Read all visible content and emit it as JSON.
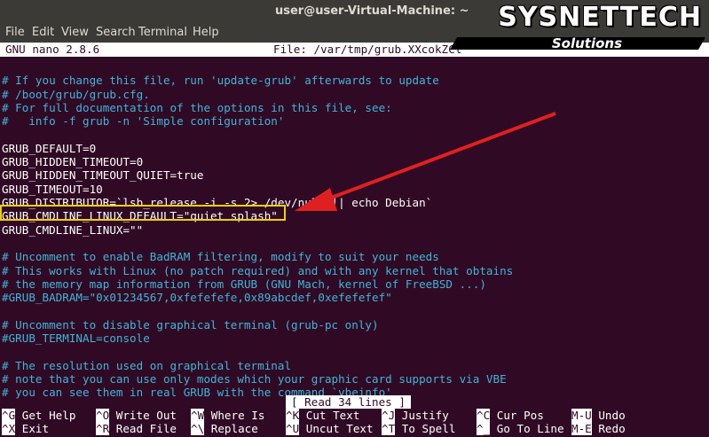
{
  "window": {
    "title": "user@user-Virtual-Machine: ~"
  },
  "menu": {
    "items": [
      "File",
      "Edit",
      "View",
      "Search",
      "Terminal",
      "Help"
    ]
  },
  "nano": {
    "version": "GNU nano 2.8.6",
    "file": "File: /var/tmp/grub.XXcokZCl",
    "lines": [
      {
        "text": "",
        "type": "plain"
      },
      {
        "text": "# If you change this file, run 'update-grub' afterwards to update",
        "type": "comment"
      },
      {
        "text": "# /boot/grub/grub.cfg.",
        "type": "comment"
      },
      {
        "text": "# For full documentation of the options in this file, see:",
        "type": "comment"
      },
      {
        "text": "#   info -f grub -n 'Simple configuration'",
        "type": "comment"
      },
      {
        "text": "",
        "type": "plain"
      },
      {
        "text": "GRUB_DEFAULT=0",
        "type": "plain"
      },
      {
        "text": "GRUB_HIDDEN_TIMEOUT=0",
        "type": "plain"
      },
      {
        "text": "GRUB_HIDDEN_TIMEOUT_QUIET=true",
        "type": "plain"
      },
      {
        "text": "GRUB_TIMEOUT=10",
        "type": "plain"
      },
      {
        "text": "GRUB_DISTRIBUTOR=`lsb_release -i -s 2> /dev/null || echo Debian`",
        "type": "plain"
      },
      {
        "text": "GRUB_CMDLINE_LINUX_DEFAULT=\"quiet splash\"",
        "type": "plain"
      },
      {
        "text": "GRUB_CMDLINE_LINUX=\"\"",
        "type": "plain"
      },
      {
        "text": "",
        "type": "plain"
      },
      {
        "text": "# Uncomment to enable BadRAM filtering, modify to suit your needs",
        "type": "comment"
      },
      {
        "text": "# This works with Linux (no patch required) and with any kernel that obtains",
        "type": "comment"
      },
      {
        "text": "# the memory map information from GRUB (GNU Mach, kernel of FreeBSD ...)",
        "type": "comment"
      },
      {
        "text": "#GRUB_BADRAM=\"0x01234567,0xfefefefe,0x89abcdef,0xefefefef\"",
        "type": "comment"
      },
      {
        "text": "",
        "type": "plain"
      },
      {
        "text": "# Uncomment to disable graphical terminal (grub-pc only)",
        "type": "comment"
      },
      {
        "text": "#GRUB_TERMINAL=console",
        "type": "comment"
      },
      {
        "text": "",
        "type": "plain"
      },
      {
        "text": "# The resolution used on graphical terminal",
        "type": "comment"
      },
      {
        "text": "# note that you can use only modes which your graphic card supports via VBE",
        "type": "comment"
      },
      {
        "text": "# you can see them in real GRUB with the command `vbeinfo'",
        "type": "comment"
      }
    ],
    "status": "[ Read 34 lines ]",
    "shortcuts_row1": [
      {
        "key": "^G",
        "label": "Get Help"
      },
      {
        "key": "^O",
        "label": "Write Out"
      },
      {
        "key": "^W",
        "label": "Where Is"
      },
      {
        "key": "^K",
        "label": "Cut Text"
      },
      {
        "key": "^J",
        "label": "Justify"
      },
      {
        "key": "^C",
        "label": "Cur Pos"
      },
      {
        "key": "M-U",
        "label": "Undo"
      }
    ],
    "shortcuts_row2": [
      {
        "key": "^X",
        "label": "Exit"
      },
      {
        "key": "^R",
        "label": "Read File"
      },
      {
        "key": "^\\",
        "label": "Replace"
      },
      {
        "key": "^U",
        "label": "Uncut Text"
      },
      {
        "key": "^T",
        "label": "To Spell"
      },
      {
        "key": "^_",
        "label": "Go To Line"
      },
      {
        "key": "M-E",
        "label": "Redo"
      }
    ]
  },
  "logo": {
    "main": "SYSNETTECH",
    "sub": "Solutions"
  },
  "colors": {
    "terminal_bg": "#300a24",
    "comment": "#40b4d8",
    "highlight_box": "#f0d000",
    "arrow": "#e02020"
  }
}
